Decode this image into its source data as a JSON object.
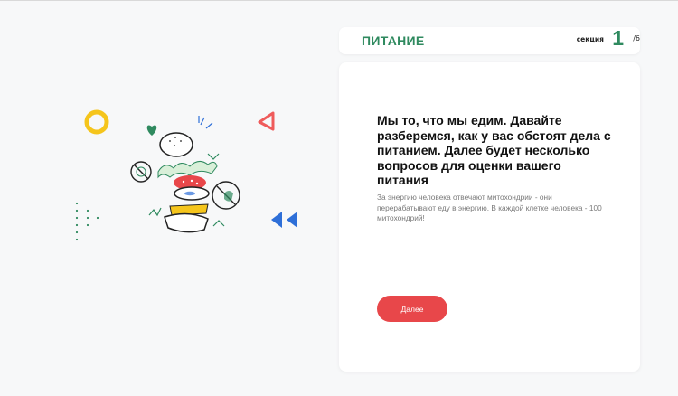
{
  "header": {
    "section_title": "ПИТАНИЕ",
    "counter_label": "секция",
    "counter_current": "1",
    "counter_total": "/6"
  },
  "content": {
    "question": "Мы то, что мы едим. Давайте разберемся, как у вас обстоят дела с питанием. Далее будет несколько вопросов для оценки вашего питания",
    "hint": "За энергию человека отвечают митохондрии - они перерабатывают еду в энергию. В каждой клетке человека - 100 митохондрий!",
    "next_button_label": "Далее"
  },
  "colors": {
    "brand_green": "#2f8a5f",
    "button_red": "#e8474a",
    "yellow_ring": "#f5c51c",
    "blue_triangles": "#2e6fd8",
    "red_triangle": "#ef5b5b"
  },
  "icons": [
    "yellow-ring-icon",
    "green-heart-icon",
    "red-triangle-icon",
    "blue-double-triangle-icon",
    "green-dots-icon",
    "burger-illustration"
  ]
}
